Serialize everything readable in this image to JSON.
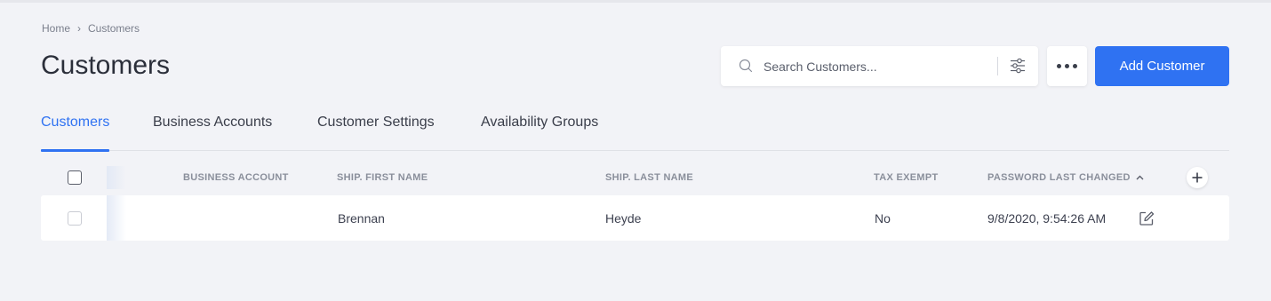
{
  "breadcrumb": {
    "home": "Home",
    "separator": "›",
    "current": "Customers"
  },
  "page": {
    "title": "Customers"
  },
  "search": {
    "placeholder": "Search Customers..."
  },
  "actions": {
    "more_icon": "more-horizontal-icon",
    "add_label": "Add Customer"
  },
  "tabs": [
    {
      "label": "Customers",
      "active": true
    },
    {
      "label": "Business Accounts",
      "active": false
    },
    {
      "label": "Customer Settings",
      "active": false
    },
    {
      "label": "Availability Groups",
      "active": false
    }
  ],
  "table": {
    "columns": [
      "BUSINESS ACCOUNT",
      "SHIP. FIRST NAME",
      "SHIP. LAST NAME",
      "TAX EXEMPT",
      "PASSWORD LAST CHANGED"
    ],
    "sort": {
      "column": "PASSWORD LAST CHANGED",
      "direction": "ascending"
    },
    "rows": [
      {
        "business_account": "",
        "ship_first_name": "Brennan",
        "ship_last_name": "Heyde",
        "tax_exempt": "No",
        "password_last_changed": "9/8/2020, 9:54:26 AM"
      }
    ]
  },
  "colors": {
    "accent": "#2f72f2",
    "background": "#f2f3f7",
    "text": "#2f3341"
  }
}
